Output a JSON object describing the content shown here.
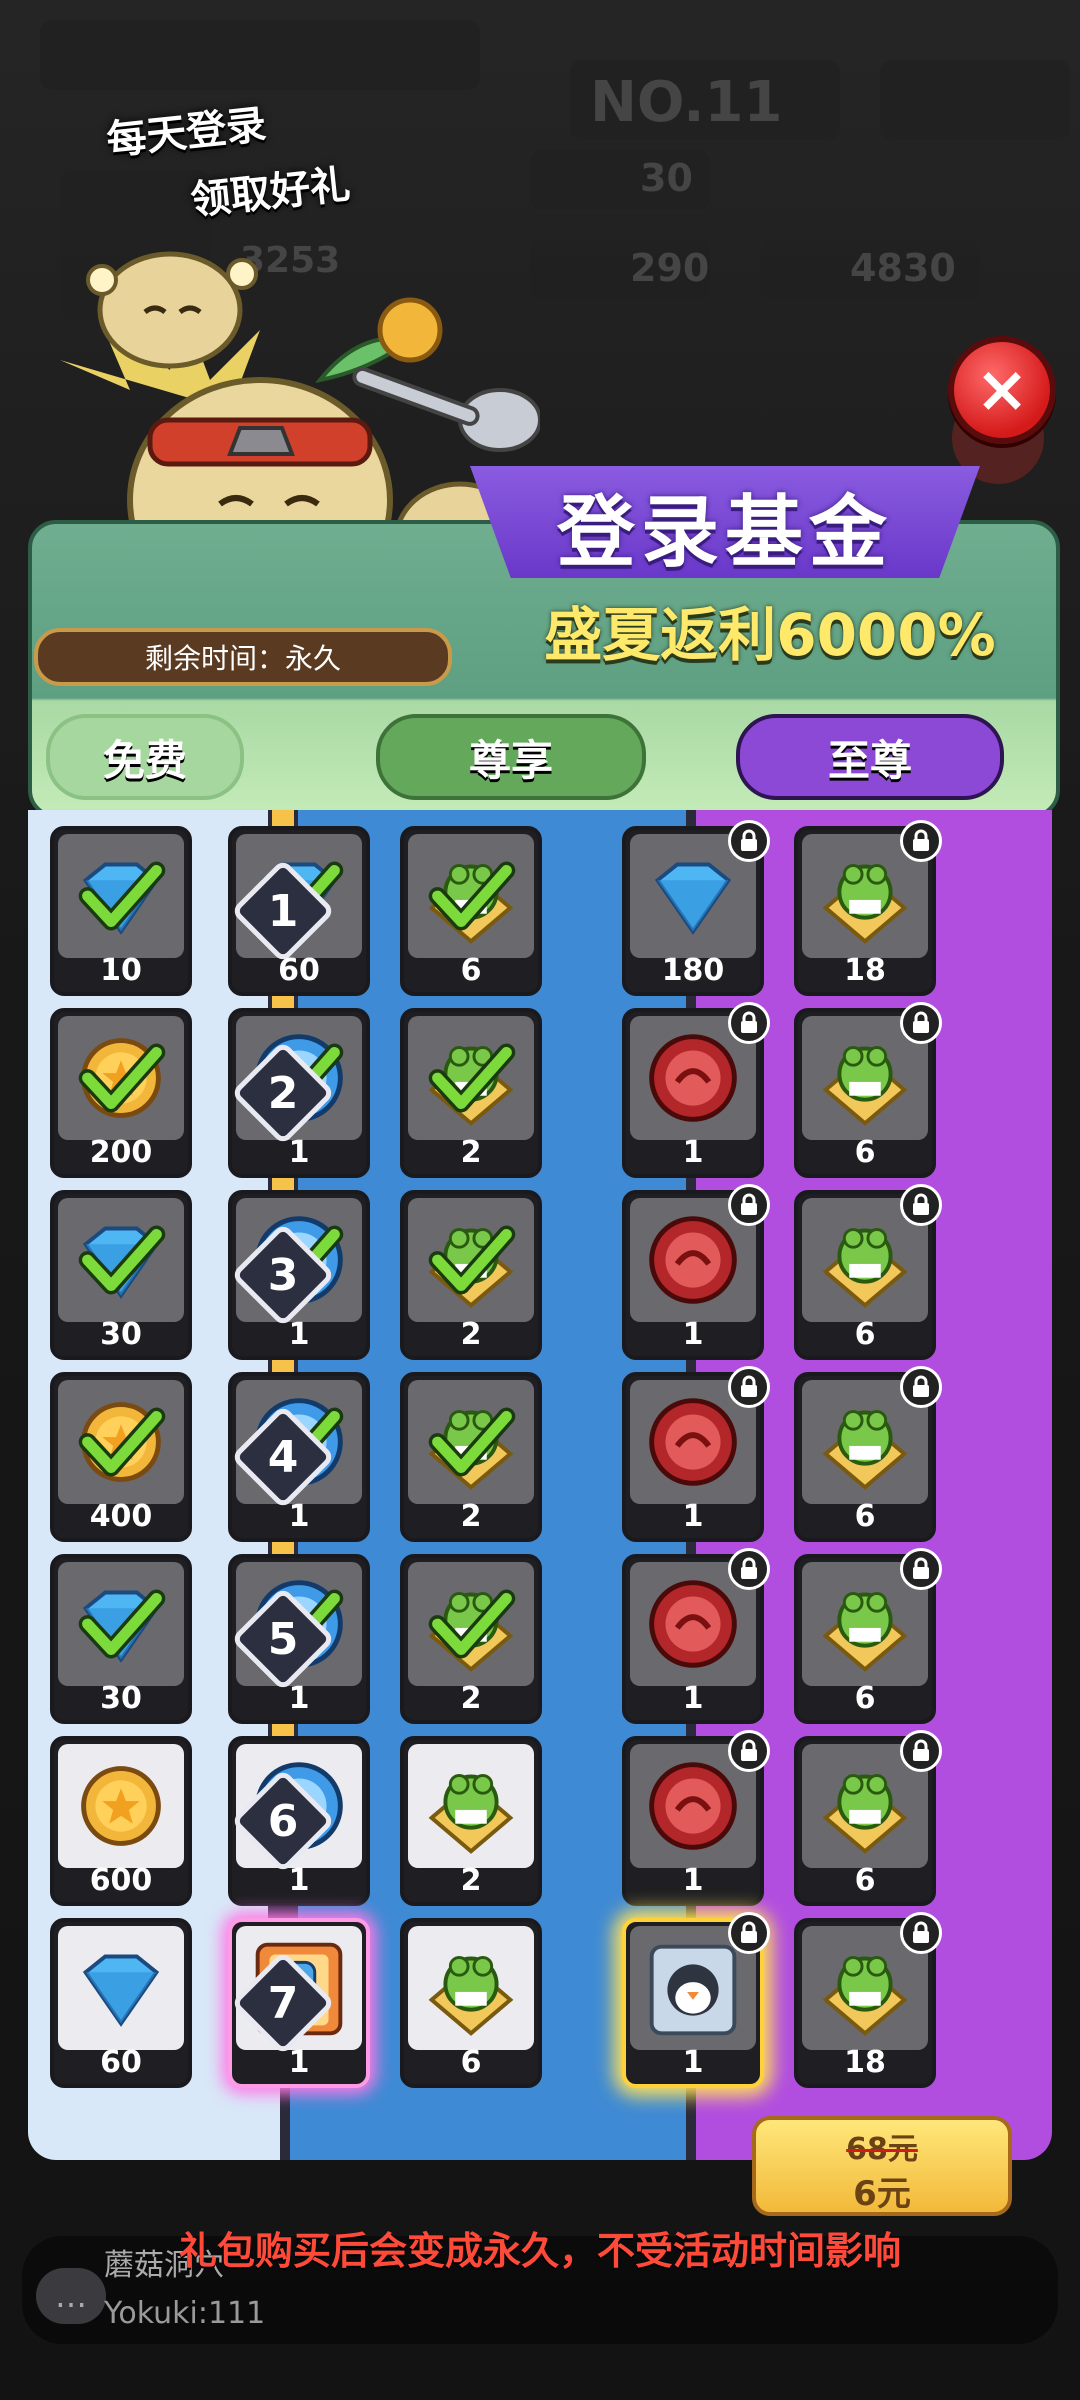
{
  "background": {
    "stats": [
      "30",
      "290",
      "4830"
    ],
    "bg_title": "NO.11",
    "bg_score": "3253"
  },
  "header": {
    "login_note_1": "每天登录",
    "login_note_2": "领取好礼",
    "title": "登录基金",
    "rebate": "盛夏返利6000%",
    "remaining_time": "剩余时间：永久"
  },
  "tabs": [
    {
      "label": "免费"
    },
    {
      "label": "尊享"
    },
    {
      "label": "至尊"
    }
  ],
  "days": [
    "1",
    "2",
    "3",
    "4",
    "5",
    "6",
    "7"
  ],
  "rewards": {
    "free": [
      {
        "icon": "diamond-icon",
        "qty": "10",
        "claimed": true
      },
      {
        "icon": "gold-coin-icon",
        "qty": "200",
        "claimed": true
      },
      {
        "icon": "diamond-icon",
        "qty": "30",
        "claimed": true
      },
      {
        "icon": "gold-coin-icon",
        "qty": "400",
        "claimed": true
      },
      {
        "icon": "diamond-icon",
        "qty": "30",
        "claimed": true
      },
      {
        "icon": "gold-coin-icon",
        "qty": "600",
        "claimed": false
      },
      {
        "icon": "diamond-icon",
        "qty": "60",
        "claimed": false
      }
    ],
    "vip_a": [
      {
        "icon": "diamond-icon",
        "qty": "60",
        "claimed": true
      },
      {
        "icon": "blue-token-icon",
        "qty": "1",
        "claimed": true
      },
      {
        "icon": "blue-token-icon",
        "qty": "1",
        "claimed": true
      },
      {
        "icon": "blue-token-icon",
        "qty": "1",
        "claimed": true
      },
      {
        "icon": "blue-token-icon",
        "qty": "1",
        "claimed": true
      },
      {
        "icon": "blue-token-icon",
        "qty": "1",
        "claimed": false
      },
      {
        "icon": "character-card-icon",
        "qty": "1",
        "claimed": false
      }
    ],
    "vip_b": [
      {
        "icon": "frog-ticket-icon",
        "qty": "6",
        "claimed": true
      },
      {
        "icon": "frog-ticket-icon",
        "qty": "2",
        "claimed": true
      },
      {
        "icon": "frog-ticket-icon",
        "qty": "2",
        "claimed": true
      },
      {
        "icon": "frog-ticket-icon",
        "qty": "2",
        "claimed": true
      },
      {
        "icon": "frog-ticket-icon",
        "qty": "2",
        "claimed": true
      },
      {
        "icon": "frog-ticket-icon",
        "qty": "2",
        "claimed": false
      },
      {
        "icon": "frog-ticket-icon",
        "qty": "6",
        "claimed": false
      }
    ],
    "svip_a": [
      {
        "icon": "diamond-icon",
        "qty": "180"
      },
      {
        "icon": "red-token-icon",
        "qty": "1"
      },
      {
        "icon": "red-token-icon",
        "qty": "1"
      },
      {
        "icon": "red-token-icon",
        "qty": "1"
      },
      {
        "icon": "red-token-icon",
        "qty": "1"
      },
      {
        "icon": "red-token-icon",
        "qty": "1"
      },
      {
        "icon": "penguin-card-icon",
        "qty": "1"
      }
    ],
    "svip_b": [
      {
        "icon": "frog-ticket-icon",
        "qty": "18"
      },
      {
        "icon": "frog-ticket-icon",
        "qty": "6"
      },
      {
        "icon": "frog-ticket-icon",
        "qty": "6"
      },
      {
        "icon": "frog-ticket-icon",
        "qty": "6"
      },
      {
        "icon": "frog-ticket-icon",
        "qty": "6"
      },
      {
        "icon": "frog-ticket-icon",
        "qty": "6"
      },
      {
        "icon": "frog-ticket-icon",
        "qty": "18"
      }
    ]
  },
  "price": {
    "old": "68元",
    "new": "6元"
  },
  "notice": "礼包购买后会变成永久，不受活动时间影响",
  "chat": {
    "name": "蘑菇洞穴",
    "message": "Yokuki:111"
  },
  "colors": {
    "free_column": "#d8e8f8",
    "vip_column": "#3f8ad4",
    "svip_column": "#b14ee0",
    "check_green": "#7cdb3a",
    "notice_red": "#ff4a3a"
  }
}
